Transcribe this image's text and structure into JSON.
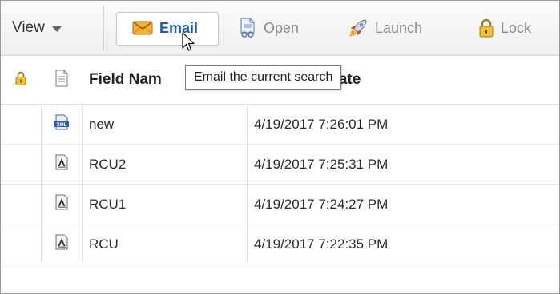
{
  "toolbar": {
    "view_label": "View",
    "email_label": "Email",
    "open_label": "Open",
    "launch_label": "Launch",
    "lock_label": "Lock"
  },
  "tooltip": {
    "text": "Email the current search"
  },
  "table": {
    "headers": [
      "Field Nam",
      "tion Date"
    ],
    "rows": [
      {
        "type_icon": "xml-file-icon",
        "name": "new",
        "date": "4/19/2017 7:26:01 PM"
      },
      {
        "type_icon": "pdf-file-icon",
        "name": "RCU2",
        "date": "4/19/2017 7:25:31 PM"
      },
      {
        "type_icon": "pdf-file-icon",
        "name": "RCU1",
        "date": "4/19/2017 7:24:27 PM"
      },
      {
        "type_icon": "pdf-file-icon",
        "name": "RCU",
        "date": "4/19/2017 7:22:35 PM"
      }
    ]
  },
  "colors": {
    "email_text": "#1f5fa8",
    "disabled_text": "#8c8c8c",
    "lock_yellow": "#e8a81c"
  }
}
